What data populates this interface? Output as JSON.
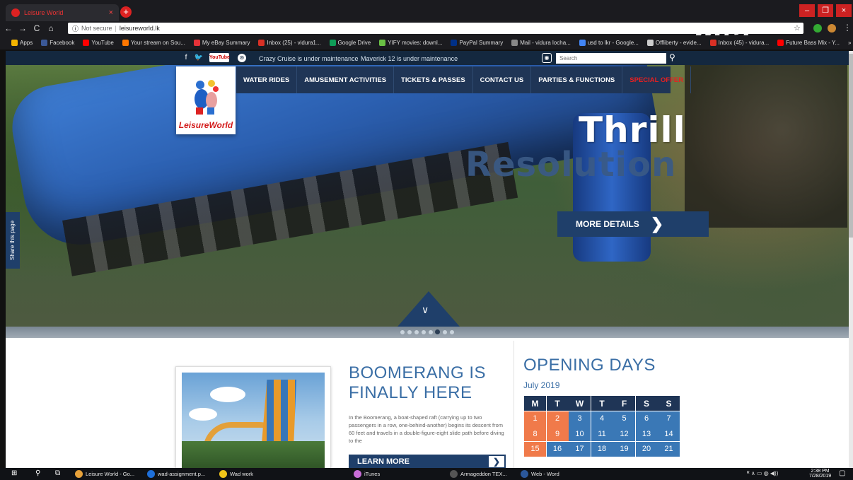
{
  "browser": {
    "tab_title": "Leisure World",
    "tab_close": "×",
    "new_tab": "+",
    "nav": [
      "←",
      "→",
      "C",
      "⌂"
    ],
    "not_secure": "Not secure",
    "url": "leisureworld.lk",
    "win_min": "–",
    "win_max": "❐",
    "win_close": "×",
    "brand_overlay": "msi",
    "bookmarks": [
      {
        "label": "Apps",
        "color": "#f4b400"
      },
      {
        "label": "Facebook",
        "color": "#3b5998"
      },
      {
        "label": "YouTube",
        "color": "#ff0000"
      },
      {
        "label": "Your stream on Sou...",
        "color": "#ff7700"
      },
      {
        "label": "My eBay Summary",
        "color": "#e53238"
      },
      {
        "label": "Inbox (25) - vidura1...",
        "color": "#d93025"
      },
      {
        "label": "Google Drive",
        "color": "#0f9d58"
      },
      {
        "label": "YIFY movies: downl...",
        "color": "#6ac045"
      },
      {
        "label": "PayPal Summary",
        "color": "#003087"
      },
      {
        "label": "Mail - vidura locha...",
        "color": "#888888"
      },
      {
        "label": "usd to lkr - Google...",
        "color": "#4285f4"
      },
      {
        "label": "Offliberty - evide...",
        "color": "#cccccc"
      },
      {
        "label": "Inbox (45) - vidura...",
        "color": "#d93025"
      },
      {
        "label": "Future Bass Mix - Y...",
        "color": "#ff0000"
      }
    ],
    "bookmarks_more": "»"
  },
  "site": {
    "youtube_label": "YouTube",
    "maintenance": [
      "Crazy Cruise is under maintenance",
      "Maverick 12 is under maintenance"
    ],
    "search_placeholder": "Search",
    "logo_text": "LeisureWorld",
    "menu": [
      {
        "label": "WATER RIDES",
        "special": false
      },
      {
        "label": "AMUSEMENT ACTIVITIES",
        "special": false
      },
      {
        "label": "TICKETS & PASSES",
        "special": false
      },
      {
        "label": "CONTACT US",
        "special": false
      },
      {
        "label": "PARTIES & FUNCTIONS",
        "special": false
      },
      {
        "label": "SPECIAL OFFER",
        "special": true
      }
    ],
    "hero": {
      "headline": "Thrill",
      "subheadline": "Resolution",
      "cta": "MORE DETAILS",
      "cta_icon": "❯",
      "share_label": "Share this page",
      "down_icon": "∨"
    },
    "feature": {
      "title_line1": "BOOMERANG IS",
      "title_line2": "FINALLY HERE",
      "description": "In the Boomerang, a boat-shaped raft (carrying up to two passengers in a row, one-behind-another) begins its descent from 60 feet and travels in a double-figure-eight slide path before diving to the",
      "cta": "LEARN MORE",
      "cta_icon": "❯"
    },
    "opening_days": {
      "heading": "OPENING DAYS",
      "month": "July 2019",
      "weekdays": [
        "M",
        "T",
        "W",
        "T",
        "F",
        "S",
        "S"
      ],
      "rows": [
        [
          {
            "d": "1",
            "s": "closed"
          },
          {
            "d": "2",
            "s": "closed"
          },
          {
            "d": "3",
            "s": "open"
          },
          {
            "d": "4",
            "s": "open"
          },
          {
            "d": "5",
            "s": "open"
          },
          {
            "d": "6",
            "s": "open"
          },
          {
            "d": "7",
            "s": "open"
          }
        ],
        [
          {
            "d": "8",
            "s": "closed"
          },
          {
            "d": "9",
            "s": "closed"
          },
          {
            "d": "10",
            "s": "open"
          },
          {
            "d": "11",
            "s": "open"
          },
          {
            "d": "12",
            "s": "open"
          },
          {
            "d": "13",
            "s": "open"
          },
          {
            "d": "14",
            "s": "open"
          }
        ],
        [
          {
            "d": "15",
            "s": "closed"
          },
          {
            "d": "16",
            "s": "open"
          },
          {
            "d": "17",
            "s": "open"
          },
          {
            "d": "18",
            "s": "open"
          },
          {
            "d": "19",
            "s": "open"
          },
          {
            "d": "20",
            "s": "open"
          },
          {
            "d": "21",
            "s": "open"
          }
        ]
      ]
    }
  },
  "taskbar": {
    "items": [
      {
        "label": "Leisure World - Go...",
        "color": "#e8a23a"
      },
      {
        "label": "wad-assignment.p...",
        "color": "#1e6fd9"
      },
      {
        "label": "Wad work",
        "color": "#f0c419"
      },
      {
        "label": "iTunes",
        "color": "#c86dd7"
      },
      {
        "label": "Armageddon TEX...",
        "color": "#555555"
      },
      {
        "label": "Web - Word",
        "color": "#2b579a"
      }
    ],
    "time": "2:38 PM",
    "date": "7/28/2019"
  },
  "colors": {
    "accent": "#1f3f6a",
    "heading_blue": "#3a6ea5",
    "special_red": "#e82020",
    "closed_orange": "#f07a4a",
    "open_blue": "#3a78b6"
  }
}
